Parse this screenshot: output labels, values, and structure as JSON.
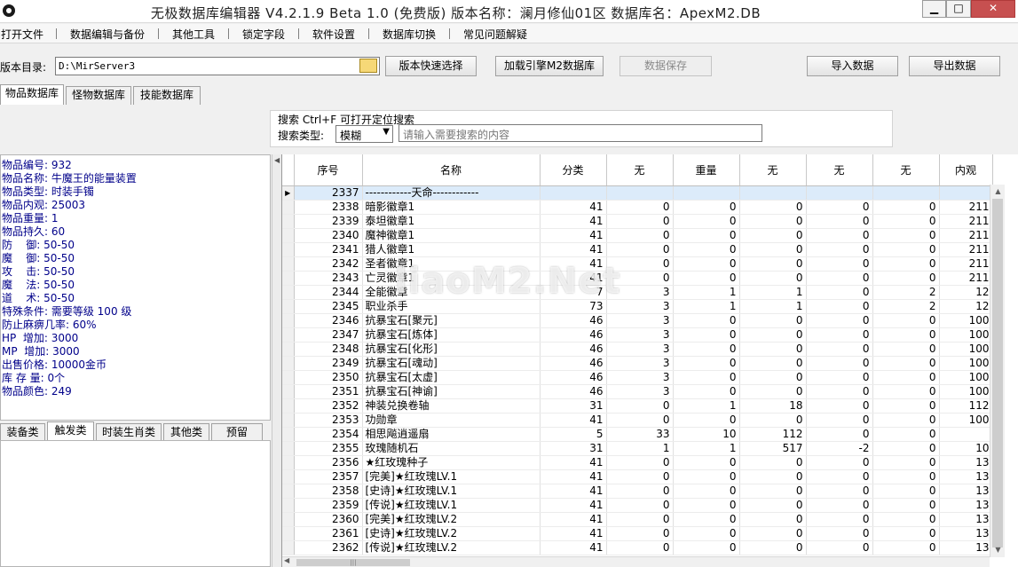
{
  "window": {
    "title": "无极数据库编辑器 V4.2.1.9   Beta 1.0 (免费版)   版本名称：澜月修仙01区   数据库名：ApexM2.DB",
    "minimize": "▁",
    "maximize": "□",
    "close": "✕"
  },
  "menu": [
    "打开文件",
    "数据编辑与备份",
    "其他工具",
    "锁定字段",
    "软件设置",
    "数据库切换",
    "常见问题解疑"
  ],
  "toolbar": {
    "dir_label": "版本目录:",
    "dir_value": "D:\\MirServer3",
    "quick_select": "版本快速选择",
    "load_engine": "加载引擎M2数据库",
    "save_data": "数据保存",
    "import_data": "导入数据",
    "export_data": "导出数据"
  },
  "tabs_main": [
    "物品数据库",
    "怪物数据库",
    "技能数据库"
  ],
  "search": {
    "title": "搜索   Ctrl+F 可打开定位搜索",
    "type_label": "搜索类型:",
    "type_value": "模糊",
    "placeholder": "请输入需要搜索的内容"
  },
  "info": [
    "物品编号: 932",
    "物品名称: 牛魔王的能量装置",
    "物品类型: 时装手镯",
    "物品内观: 25003",
    "物品重量: 1",
    "物品持久: 60",
    "防    御: 50-50",
    "魔    御: 50-50",
    "攻    击: 50-50",
    "魔    法: 50-50",
    "道    术: 50-50",
    "特殊条件: 需要等级 100 级",
    "防止麻痹几率: 60%",
    "HP  增加: 3000",
    "MP  增加: 3000",
    "出售价格: 10000金币",
    "库 存 量: 0个",
    "物品颜色: 249"
  ],
  "tabs_bottom": [
    "装备类",
    "触发类",
    "时装生肖类",
    "其他类",
    "预留"
  ],
  "grid": {
    "columns": [
      "序号",
      "名称",
      "分类",
      "无",
      "重量",
      "无",
      "无",
      "无",
      "内观"
    ],
    "rows": [
      [
        "2337",
        "------------天命------------",
        "",
        "",
        "",
        "",
        "",
        "",
        ""
      ],
      [
        "2338",
        "暗影徽章1",
        "41",
        "0",
        "0",
        "0",
        "0",
        "0",
        "211"
      ],
      [
        "2339",
        "泰坦徽章1",
        "41",
        "0",
        "0",
        "0",
        "0",
        "0",
        "211"
      ],
      [
        "2340",
        "魔神徽章1",
        "41",
        "0",
        "0",
        "0",
        "0",
        "0",
        "211"
      ],
      [
        "2341",
        "猎人徽章1",
        "41",
        "0",
        "0",
        "0",
        "0",
        "0",
        "211"
      ],
      [
        "2342",
        "圣者徽章1",
        "41",
        "0",
        "0",
        "0",
        "0",
        "0",
        "211"
      ],
      [
        "2343",
        "亡灵徽章1",
        "41",
        "0",
        "0",
        "0",
        "0",
        "0",
        "211"
      ],
      [
        "2344",
        "全能徽章",
        "7",
        "3",
        "1",
        "1",
        "0",
        "2",
        "12"
      ],
      [
        "2345",
        "职业杀手",
        "73",
        "3",
        "1",
        "1",
        "0",
        "2",
        "12"
      ],
      [
        "2346",
        "抗暴宝石[聚元]",
        "46",
        "3",
        "0",
        "0",
        "0",
        "0",
        "100"
      ],
      [
        "2347",
        "抗暴宝石[炼体]",
        "46",
        "3",
        "0",
        "0",
        "0",
        "0",
        "100"
      ],
      [
        "2348",
        "抗暴宝石[化形]",
        "46",
        "3",
        "0",
        "0",
        "0",
        "0",
        "100"
      ],
      [
        "2349",
        "抗暴宝石[魂动]",
        "46",
        "3",
        "0",
        "0",
        "0",
        "0",
        "100"
      ],
      [
        "2350",
        "抗暴宝石[太虚]",
        "46",
        "3",
        "0",
        "0",
        "0",
        "0",
        "100"
      ],
      [
        "2351",
        "抗暴宝石[神谕]",
        "46",
        "3",
        "0",
        "0",
        "0",
        "0",
        "100"
      ],
      [
        "2352",
        "神装兑换卷轴",
        "31",
        "0",
        "1",
        "18",
        "0",
        "0",
        "112"
      ],
      [
        "2353",
        "功勋章",
        "41",
        "0",
        "0",
        "0",
        "0",
        "0",
        "100"
      ],
      [
        "2354",
        "相思飚逍遥扇",
        "5",
        "33",
        "10",
        "112",
        "0",
        "0",
        ""
      ],
      [
        "2355",
        "玫瑰随机石",
        "31",
        "1",
        "1",
        "517",
        "-2",
        "0",
        "10"
      ],
      [
        "2356",
        "★红玫瑰种子",
        "41",
        "0",
        "0",
        "0",
        "0",
        "0",
        "13"
      ],
      [
        "2357",
        "[完美]★红玫瑰LV.1",
        "41",
        "0",
        "0",
        "0",
        "0",
        "0",
        "13"
      ],
      [
        "2358",
        "[史诗]★红玫瑰LV.1",
        "41",
        "0",
        "0",
        "0",
        "0",
        "0",
        "13"
      ],
      [
        "2359",
        "[传说]★红玫瑰LV.1",
        "41",
        "0",
        "0",
        "0",
        "0",
        "0",
        "13"
      ],
      [
        "2360",
        "[完美]★红玫瑰LV.2",
        "41",
        "0",
        "0",
        "0",
        "0",
        "0",
        "13"
      ],
      [
        "2361",
        "[史诗]★红玫瑰LV.2",
        "41",
        "0",
        "0",
        "0",
        "0",
        "0",
        "13"
      ],
      [
        "2362",
        "[传说]★红玫瑰LV.2",
        "41",
        "0",
        "0",
        "0",
        "0",
        "0",
        "13"
      ]
    ]
  },
  "watermark": "liaoM2.Net"
}
